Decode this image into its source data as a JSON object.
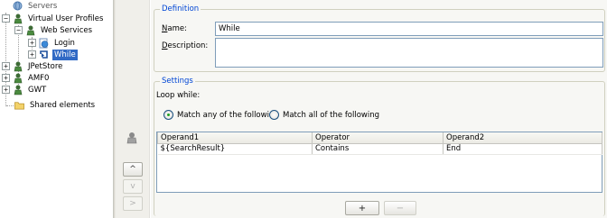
{
  "tree": {
    "items": [
      {
        "label": "Servers",
        "icon": "servers-icon"
      },
      {
        "label": "Virtual User Profiles",
        "icon": "user-profiles-icon",
        "expander": "−"
      },
      {
        "label": "Web Services",
        "icon": "user-profile-icon",
        "expander": "−"
      },
      {
        "label": "Login",
        "icon": "page-icon",
        "expander": "+"
      },
      {
        "label": "While",
        "icon": "loop-icon",
        "expander": "+",
        "selected": true
      },
      {
        "label": "JPetStore",
        "icon": "user-profile-icon",
        "expander": "+"
      },
      {
        "label": "AMF0",
        "icon": "user-profile-icon",
        "expander": "+"
      },
      {
        "label": "GWT",
        "icon": "user-profile-icon",
        "expander": "+"
      },
      {
        "label": "Shared elements",
        "icon": "folder-icon"
      }
    ]
  },
  "toolbar": {
    "icon": "shared-element-icon",
    "up": "^",
    "down": "v",
    "right": ">"
  },
  "definition": {
    "legend": "Definition",
    "name_label_u": "N",
    "name_label_rest": "ame:",
    "name_value": "While",
    "description_label_u": "D",
    "description_label_rest": "escription:",
    "description_value": ""
  },
  "settings": {
    "legend": "Settings",
    "loop_while_label": "Loop while:",
    "radio_any": "Match any of the following",
    "radio_all": "Match all of the following",
    "selected_radio": "any",
    "columns": [
      "Operand1",
      "Operator",
      "Operand2"
    ],
    "rows": [
      [
        "${SearchResult}",
        "Contains",
        "End"
      ]
    ],
    "add_button": "+",
    "remove_button": "−"
  },
  "colors": {
    "selection": "#316ac5",
    "legend_text": "#0046d5"
  }
}
